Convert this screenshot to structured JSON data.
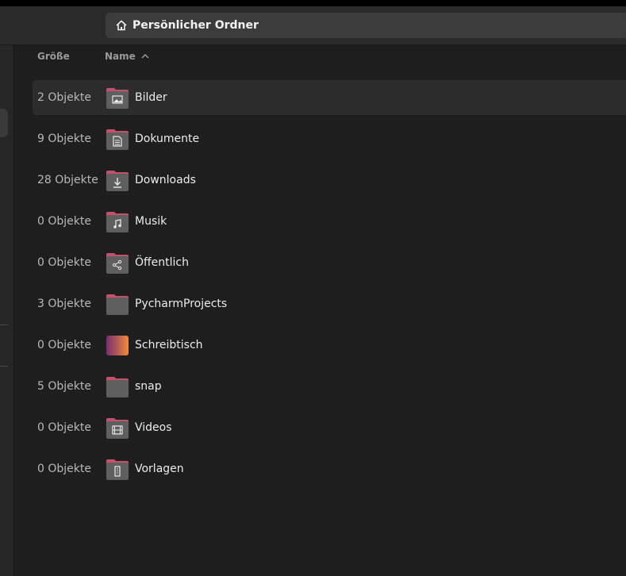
{
  "header": {
    "path_label": "Persönlicher Ordner",
    "path_icon": "home-icon"
  },
  "columns": {
    "size": "Größe",
    "name": "Name",
    "sort_icon": "sort-ascending-icon"
  },
  "folders": [
    {
      "size": "2 Objekte",
      "name": "Bilder",
      "icon": "folder-pictures-icon",
      "selected": true
    },
    {
      "size": "9 Objekte",
      "name": "Dokumente",
      "icon": "folder-documents-icon"
    },
    {
      "size": "28 Objekte",
      "name": "Downloads",
      "icon": "folder-download-icon"
    },
    {
      "size": "0 Objekte",
      "name": "Musik",
      "icon": "folder-music-icon"
    },
    {
      "size": "0 Objekte",
      "name": "Öffentlich",
      "icon": "folder-public-share-icon"
    },
    {
      "size": "3 Objekte",
      "name": "PycharmProjects",
      "icon": "folder-icon"
    },
    {
      "size": "0 Objekte",
      "name": "Schreibtisch",
      "icon": "desktop-folder-icon"
    },
    {
      "size": "5 Objekte",
      "name": "snap",
      "icon": "folder-icon"
    },
    {
      "size": "0 Objekte",
      "name": "Videos",
      "icon": "folder-videos-icon"
    },
    {
      "size": "0 Objekte",
      "name": "Vorlagen",
      "icon": "folder-templates-icon"
    }
  ],
  "colors": {
    "folder_body": "#5f5f5f",
    "folder_tab": "#c5506a",
    "desktop_gradient_start": "#7a2e6e",
    "desktop_gradient_end": "#f08a3c"
  }
}
